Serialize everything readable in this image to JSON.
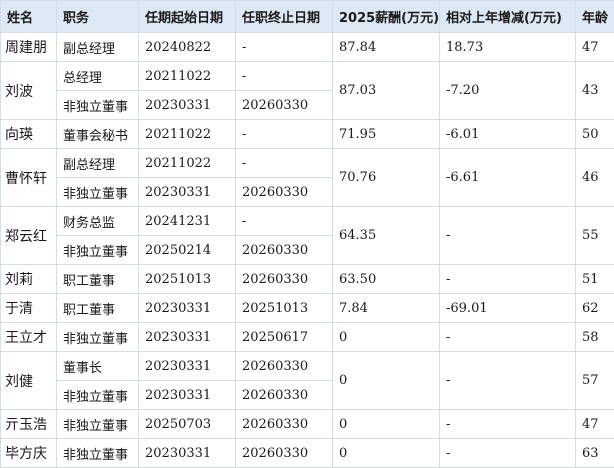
{
  "headers": [
    "姓名",
    "职务",
    "任期起始日期",
    "任职终止日期",
    "2025薪酬(万元)",
    "相对上年增减(万元)",
    "年龄"
  ],
  "people": [
    {
      "name": "周建朋",
      "salary": "87.84",
      "change": "18.73",
      "age": "47",
      "roles": [
        {
          "title": "副总经理",
          "start": "20240822",
          "end": "-"
        }
      ]
    },
    {
      "name": "刘波",
      "salary": "87.03",
      "change": "-7.20",
      "age": "43",
      "roles": [
        {
          "title": "总经理",
          "start": "20211022",
          "end": "-"
        },
        {
          "title": "非独立董事",
          "start": "20230331",
          "end": "20260330"
        }
      ]
    },
    {
      "name": "向瑛",
      "salary": "71.95",
      "change": "-6.01",
      "age": "50",
      "roles": [
        {
          "title": "董事会秘书",
          "start": "20211022",
          "end": "-"
        }
      ]
    },
    {
      "name": "曹怀轩",
      "salary": "70.76",
      "change": "-6.61",
      "age": "46",
      "roles": [
        {
          "title": "副总经理",
          "start": "20211022",
          "end": "-"
        },
        {
          "title": "非独立董事",
          "start": "20230331",
          "end": "20260330"
        }
      ]
    },
    {
      "name": "郑云红",
      "salary": "64.35",
      "change": "-",
      "age": "55",
      "roles": [
        {
          "title": "财务总监",
          "start": "20241231",
          "end": "-"
        },
        {
          "title": "非独立董事",
          "start": "20250214",
          "end": "20260330"
        }
      ]
    },
    {
      "name": "刘莉",
      "salary": "63.50",
      "change": "-",
      "age": "51",
      "roles": [
        {
          "title": "职工董事",
          "start": "20251013",
          "end": "20260330"
        }
      ]
    },
    {
      "name": "于清",
      "salary": "7.84",
      "change": "-69.01",
      "age": "62",
      "roles": [
        {
          "title": "职工董事",
          "start": "20230331",
          "end": "20251013"
        }
      ]
    },
    {
      "name": "王立才",
      "salary": "0",
      "change": "-",
      "age": "58",
      "roles": [
        {
          "title": "非独立董事",
          "start": "20230331",
          "end": "20250617"
        }
      ]
    },
    {
      "name": "刘健",
      "salary": "0",
      "change": "-",
      "age": "57",
      "roles": [
        {
          "title": "董事长",
          "start": "20230331",
          "end": "20260330"
        },
        {
          "title": "非独立董事",
          "start": "20230331",
          "end": "20260330"
        }
      ]
    },
    {
      "name": "亓玉浩",
      "salary": "0",
      "change": "-",
      "age": "47",
      "roles": [
        {
          "title": "非独立董事",
          "start": "20250703",
          "end": "20260330"
        }
      ]
    },
    {
      "name": "毕方庆",
      "salary": "0",
      "change": "-",
      "age": "63",
      "roles": [
        {
          "title": "非独立董事",
          "start": "20230331",
          "end": "20260330"
        }
      ]
    }
  ]
}
